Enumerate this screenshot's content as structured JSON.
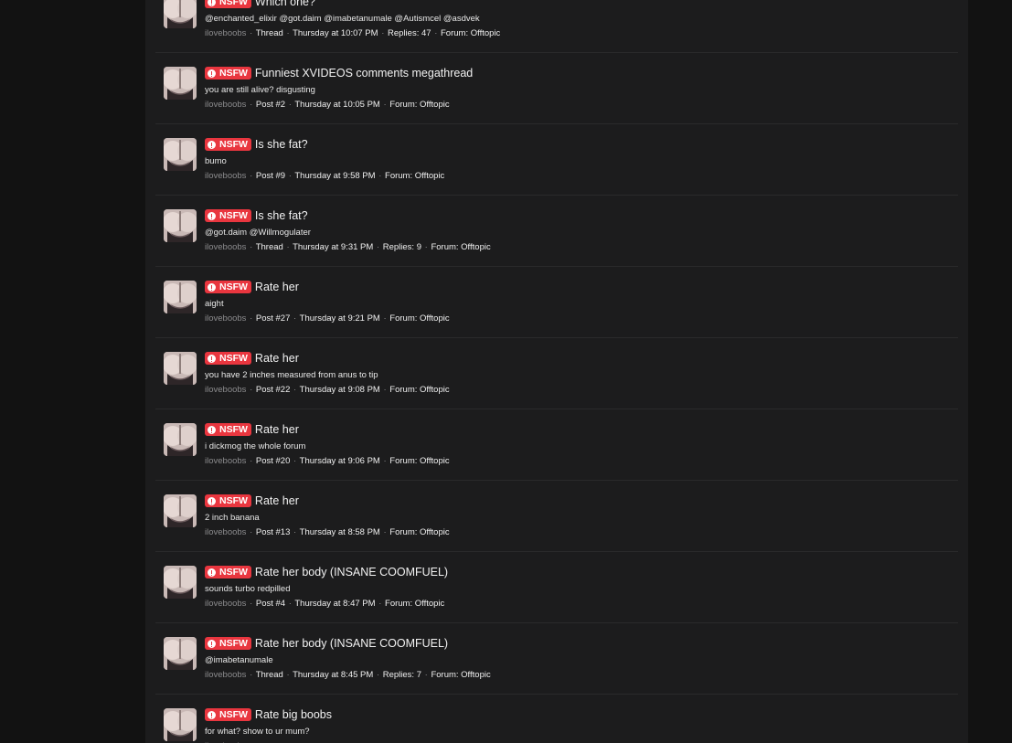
{
  "badge_label": "NSFW",
  "colors": {
    "page_background": "#121212",
    "panel_background": "#1c1c1d",
    "badge": "#e9363f",
    "username": "#8b8b8d"
  },
  "results": [
    {
      "badge": "NSFW",
      "title": "Which one?",
      "snippet": "@enchanted_elixir @got.daim @imabetanumale @Autismcel @asdvek",
      "user": "iloveboobs",
      "type": "Thread",
      "date": "Thursday at 10:07 PM",
      "replies": "Replies: 47",
      "forum": "Forum: Offtopic"
    },
    {
      "badge": "NSFW",
      "title": "Funniest XVIDEOS comments megathread",
      "snippet": "you are still alive? disgusting",
      "user": "iloveboobs",
      "type": "Post #2",
      "date": "Thursday at 10:05 PM",
      "replies": "",
      "forum": "Forum: Offtopic"
    },
    {
      "badge": "NSFW",
      "title": "Is she fat?",
      "snippet": "bumo",
      "user": "iloveboobs",
      "type": "Post #9",
      "date": "Thursday at 9:58 PM",
      "replies": "",
      "forum": "Forum: Offtopic"
    },
    {
      "badge": "NSFW",
      "title": "Is she fat?",
      "snippet": "@got.daim @Willmogulater",
      "user": "iloveboobs",
      "type": "Thread",
      "date": "Thursday at 9:31 PM",
      "replies": "Replies: 9",
      "forum": "Forum: Offtopic"
    },
    {
      "badge": "NSFW",
      "title": "Rate her",
      "snippet": "aight",
      "user": "iloveboobs",
      "type": "Post #27",
      "date": "Thursday at 9:21 PM",
      "replies": "",
      "forum": "Forum: Offtopic"
    },
    {
      "badge": "NSFW",
      "title": "Rate her",
      "snippet": "you have 2 inches measured from anus to tip",
      "user": "iloveboobs",
      "type": "Post #22",
      "date": "Thursday at 9:08 PM",
      "replies": "",
      "forum": "Forum: Offtopic"
    },
    {
      "badge": "NSFW",
      "title": "Rate her",
      "snippet": "i dickmog the whole forum",
      "user": "iloveboobs",
      "type": "Post #20",
      "date": "Thursday at 9:06 PM",
      "replies": "",
      "forum": "Forum: Offtopic"
    },
    {
      "badge": "NSFW",
      "title": "Rate her",
      "snippet": "2 inch banana",
      "user": "iloveboobs",
      "type": "Post #13",
      "date": "Thursday at 8:58 PM",
      "replies": "",
      "forum": "Forum: Offtopic"
    },
    {
      "badge": "NSFW",
      "title": "Rate her body (INSANE COOMFUEL)",
      "snippet": "sounds turbo redpilled",
      "user": "iloveboobs",
      "type": "Post #4",
      "date": "Thursday at 8:47 PM",
      "replies": "",
      "forum": "Forum: Offtopic"
    },
    {
      "badge": "NSFW",
      "title": "Rate her body (INSANE COOMFUEL)",
      "snippet": "@imabetanumale",
      "user": "iloveboobs",
      "type": "Thread",
      "date": "Thursday at 8:45 PM",
      "replies": "Replies: 7",
      "forum": "Forum: Offtopic"
    },
    {
      "badge": "NSFW",
      "title": "Rate big boobs",
      "snippet": "for what? show to ur mum?",
      "user": "iloveboobs",
      "type": "",
      "date": "",
      "replies": "",
      "forum": ""
    }
  ]
}
